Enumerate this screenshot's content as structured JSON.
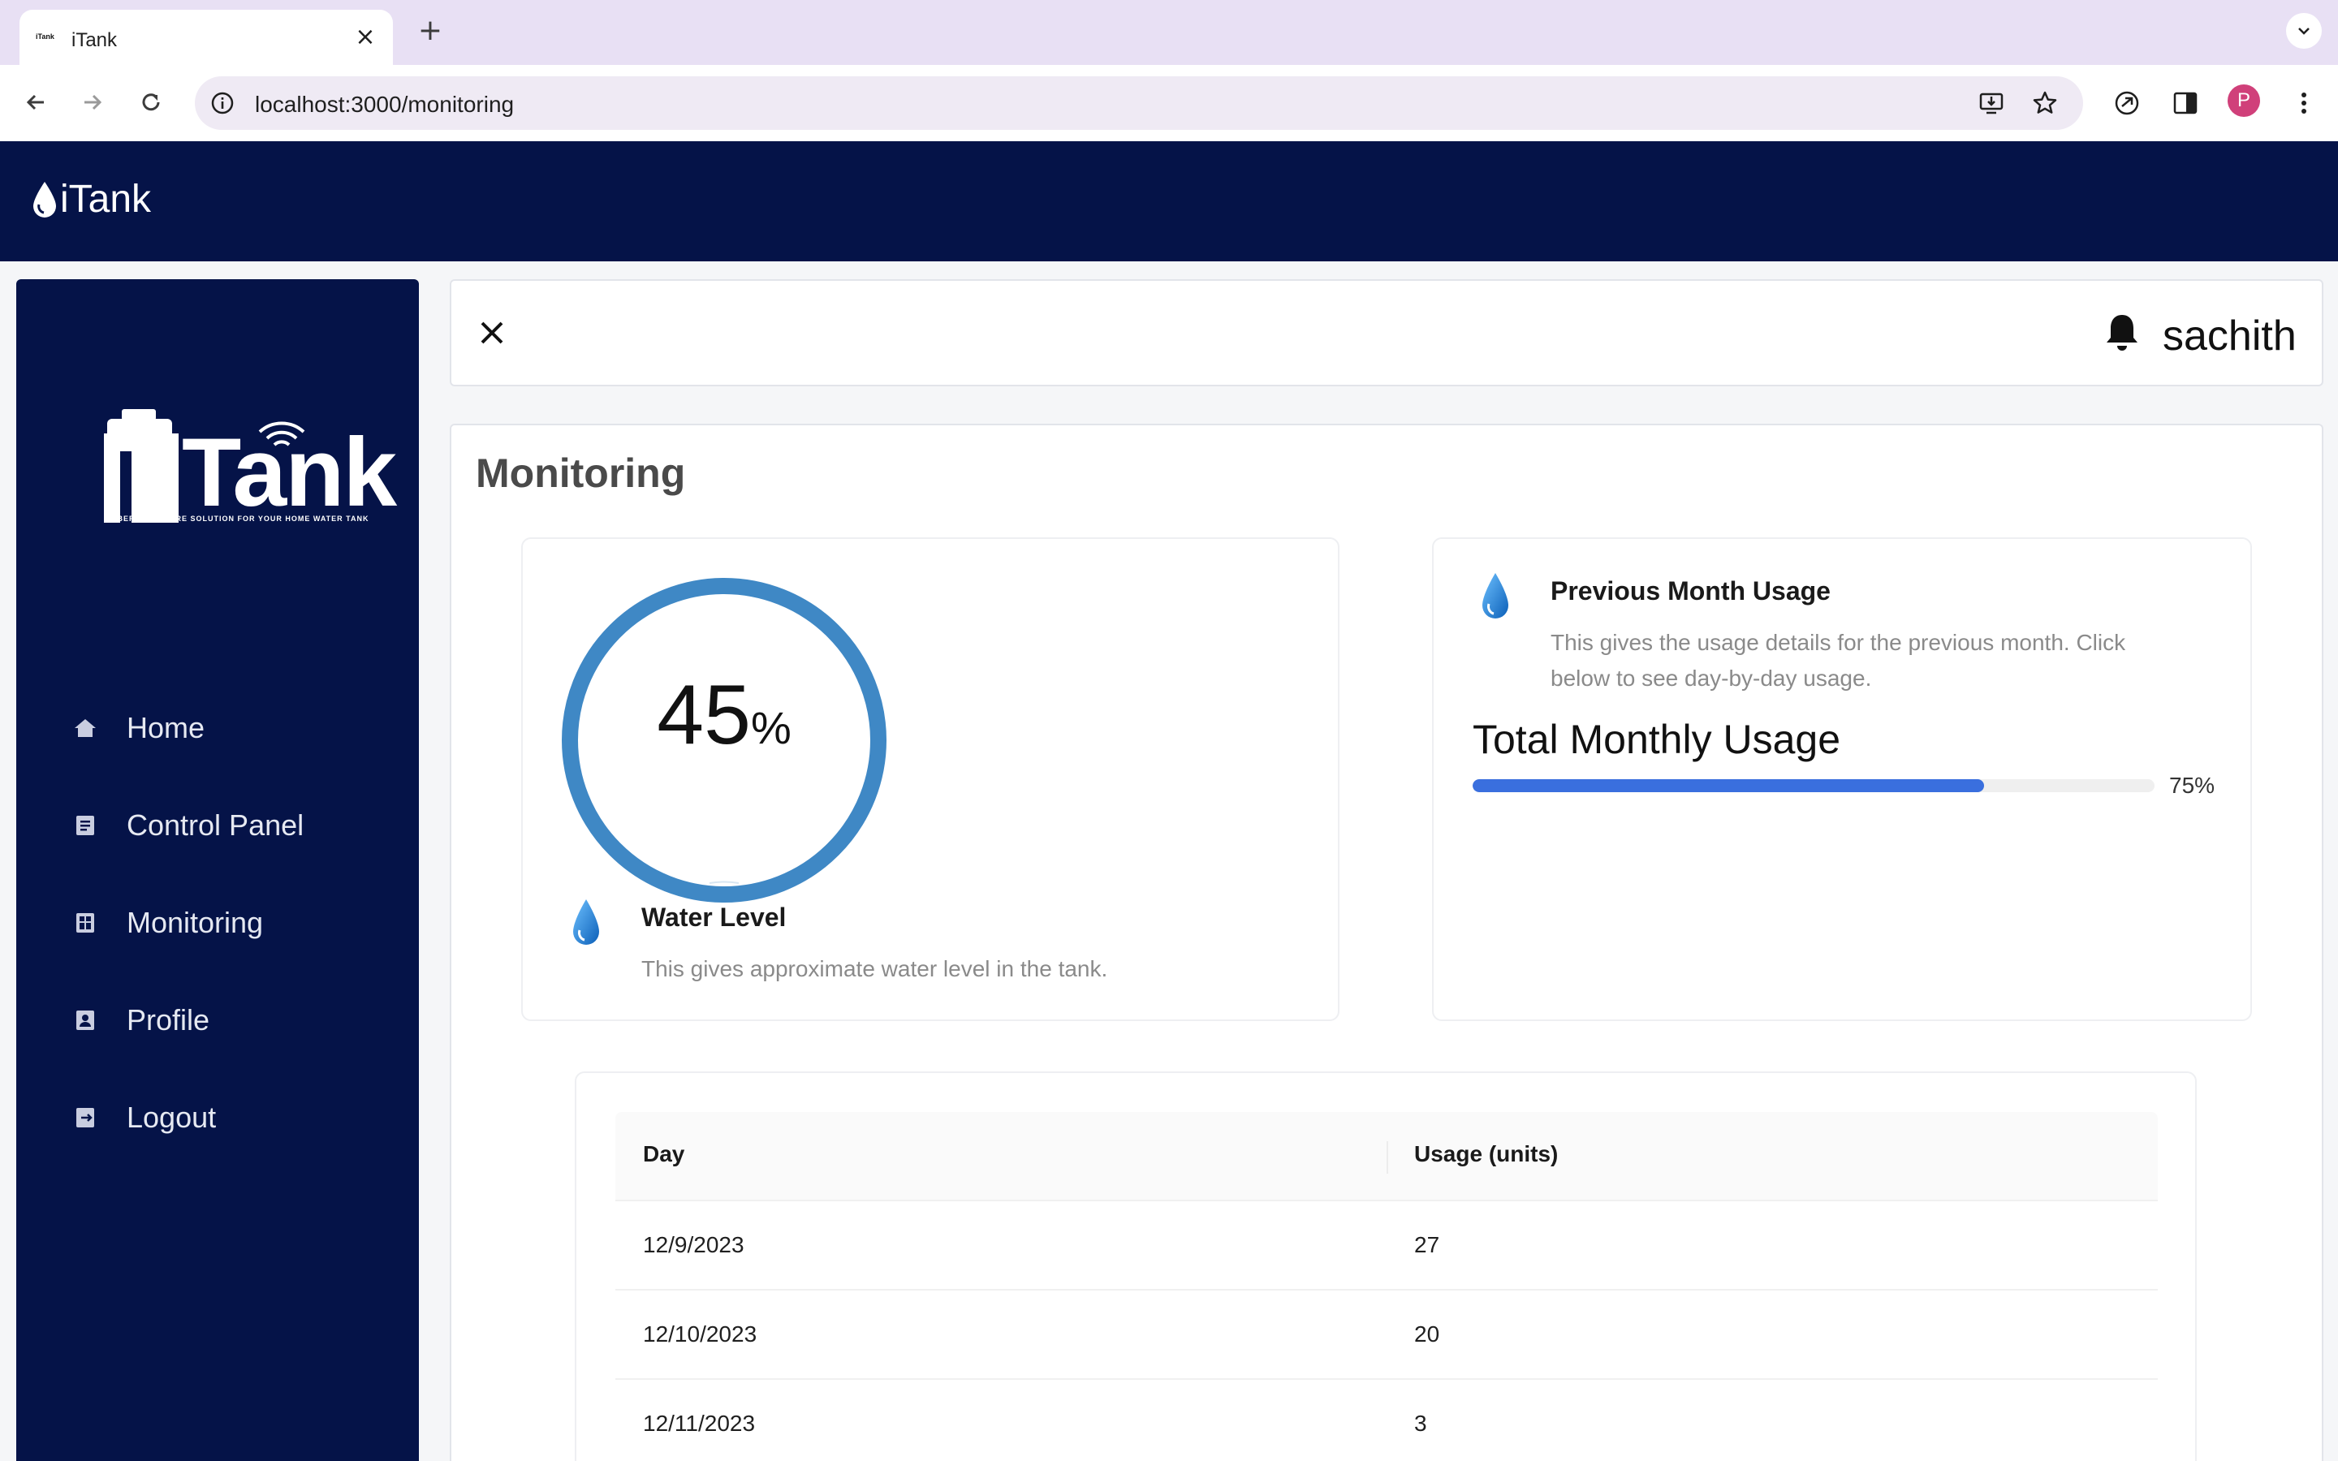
{
  "browser": {
    "tab_title": "iTank",
    "tab_favicon_text": "iTank",
    "url": "localhost:3000/monitoring",
    "profile_initial": "P"
  },
  "app": {
    "logo_text": "iTank"
  },
  "sidebar": {
    "brand_word": "Tank",
    "brand_tagline": "CYBER HARDWARE SOLUTION FOR YOUR HOME WATER TANK",
    "items": [
      {
        "label": "Home",
        "icon": "home-icon"
      },
      {
        "label": "Control Panel",
        "icon": "document-icon"
      },
      {
        "label": "Monitoring",
        "icon": "dashboard-icon"
      },
      {
        "label": "Profile",
        "icon": "profile-icon"
      },
      {
        "label": "Logout",
        "icon": "logout-icon"
      }
    ]
  },
  "topbar": {
    "username": "sachith"
  },
  "main": {
    "title": "Monitoring",
    "water_level": {
      "value": "45",
      "unit": "%",
      "fraction": 0.45,
      "title": "Water Level",
      "description": "This gives approximate water level in the tank."
    },
    "usage": {
      "title": "Previous Month Usage",
      "description_line1": "This gives the usage details for the previous month. Click",
      "description_line2": "below to see day-by-day usage.",
      "heading": "Total Monthly Usage",
      "percent": 75,
      "percent_label": "75%"
    },
    "table": {
      "columns": [
        "Day",
        "Usage (units)"
      ],
      "rows": [
        [
          "12/9/2023",
          "27"
        ],
        [
          "12/10/2023",
          "20"
        ],
        [
          "12/11/2023",
          "3"
        ]
      ]
    }
  },
  "colors": {
    "navy": "#051348",
    "gauge": "#3f88c5",
    "progress": "#3a6fde"
  }
}
